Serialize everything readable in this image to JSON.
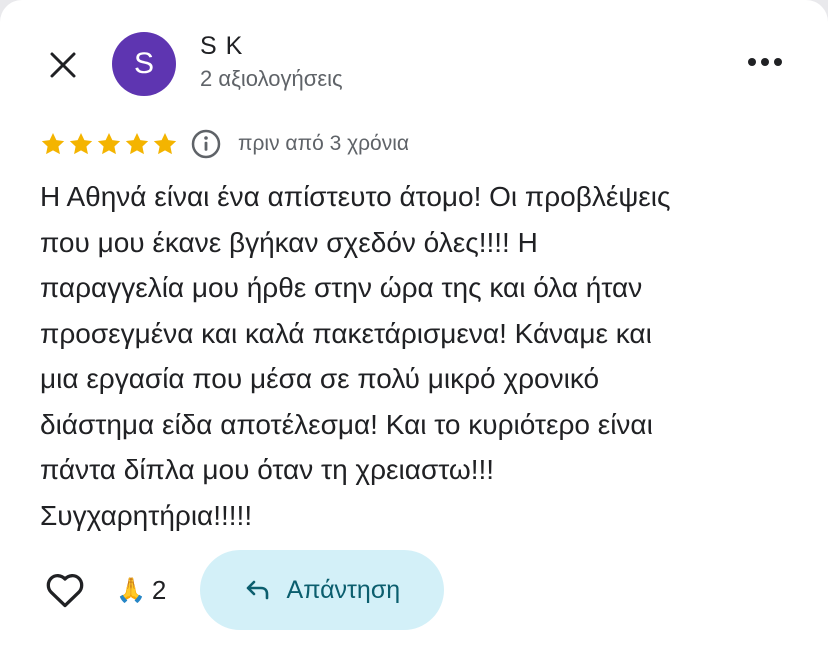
{
  "reviewer": {
    "avatar_letter": "S",
    "name": "S K",
    "review_count": "2 αξιολογήσεις",
    "avatar_color": "#5e35b1"
  },
  "review": {
    "stars": 5,
    "time_ago": "πριν από 3 χρόνια",
    "text": "Η Αθηνά είναι ένα απίστευτο άτομο! Οι προβλέψεις\nπου μου έκανε βγήκαν σχεδόν όλες!!!! Η\nπαραγγελία μου ήρθε στην ώρα της και όλα ήταν\nπροσεγμένα και καλά πακετάρισμενα! Κάναμε και\nμια εργασία που μέσα σε πολύ μικρό χρονικό\nδιάστημα είδα αποτέλεσμα! Και το κυριότερο είναι\nπάντα δίπλα μου όταν τη χρειαστω!!!\nΣυγχαρητήρια!!!!!"
  },
  "actions": {
    "reaction_emoji": "🙏",
    "reaction_count": "2",
    "reply_label": "Απάντηση"
  },
  "icons": {
    "close": "close-icon",
    "more": "more-horiz-icon",
    "star": "star-icon",
    "info": "info-icon",
    "like": "heart-outline-icon",
    "reply": "reply-arrow-icon"
  },
  "colors": {
    "star": "#f4b400",
    "reply_button_bg": "#d3f0f8",
    "reply_text": "#0b5e6e"
  }
}
